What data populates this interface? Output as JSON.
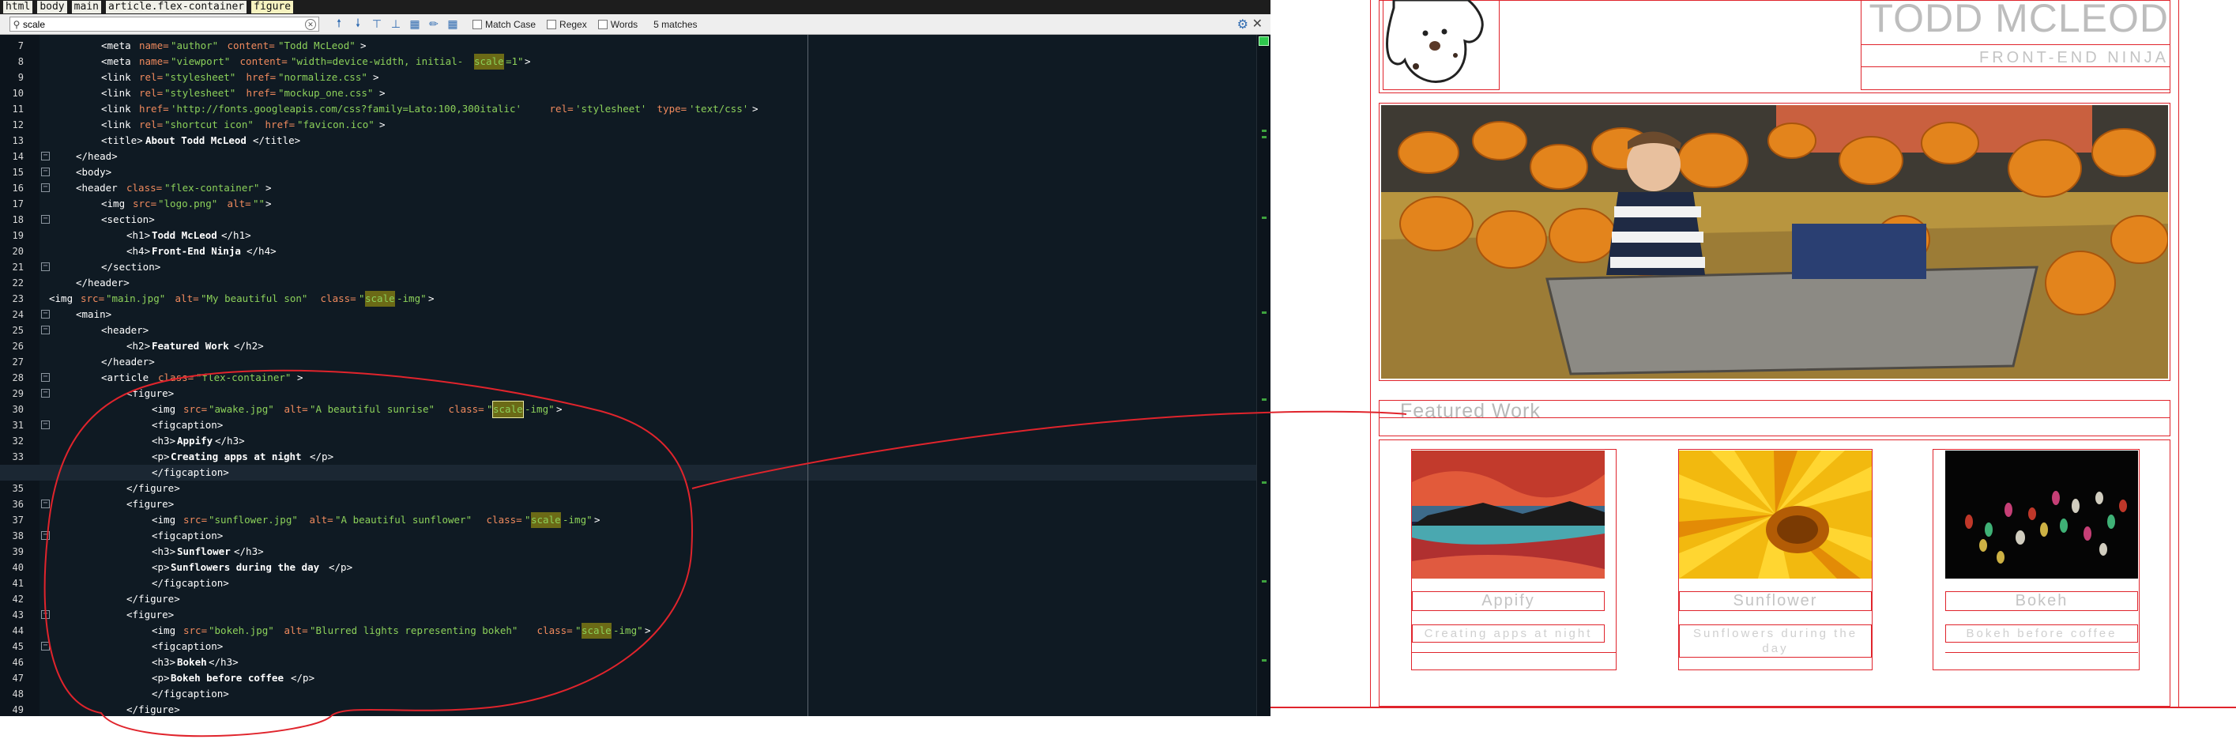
{
  "breadcrumb": [
    "html",
    "body",
    "main",
    "article.flex-container",
    "figure"
  ],
  "search": {
    "value": "scale",
    "match_case_label": "Match Case",
    "regex_label": "Regex",
    "words_label": "Words",
    "matches_label": "5 matches"
  },
  "editor": {
    "lines": [
      {
        "n": "7",
        "p": [
          [
            "t",
            "<meta "
          ],
          [
            "a",
            "name="
          ],
          [
            "s",
            "\"author\""
          ],
          [
            "a",
            " content="
          ],
          [
            "s",
            "\"Todd McLeod\""
          ],
          [
            "t",
            ">"
          ]
        ]
      },
      {
        "n": "8",
        "p": [
          [
            "t",
            "<meta "
          ],
          [
            "a",
            "name="
          ],
          [
            "s",
            "\"viewport\""
          ],
          [
            "a",
            " content="
          ],
          [
            "s",
            "\"width=device-width, initial-"
          ],
          [
            "h",
            "scale"
          ],
          [
            "s",
            "=1\""
          ],
          [
            "t",
            ">"
          ]
        ]
      },
      {
        "n": "9",
        "p": [
          [
            "t",
            "<link "
          ],
          [
            "a",
            "rel="
          ],
          [
            "s",
            "\"stylesheet\""
          ],
          [
            "a",
            " href="
          ],
          [
            "s",
            "\"normalize.css\""
          ],
          [
            "t",
            ">"
          ]
        ]
      },
      {
        "n": "10",
        "p": [
          [
            "t",
            "<link "
          ],
          [
            "a",
            "rel="
          ],
          [
            "s",
            "\"stylesheet\""
          ],
          [
            "a",
            " href="
          ],
          [
            "s",
            "\"mockup_one.css\""
          ],
          [
            "t",
            ">"
          ]
        ]
      },
      {
        "n": "11",
        "p": [
          [
            "t",
            "<link "
          ],
          [
            "a",
            "href="
          ],
          [
            "s",
            "'http://fonts.googleapis.com/css?family=Lato:100,300italic'"
          ],
          [
            "a",
            " rel="
          ],
          [
            "s",
            "'stylesheet'"
          ],
          [
            "a",
            " type="
          ],
          [
            "s",
            "'text/css'"
          ],
          [
            "t",
            ">"
          ]
        ]
      },
      {
        "n": "12",
        "p": [
          [
            "t",
            "<link "
          ],
          [
            "a",
            "rel="
          ],
          [
            "s",
            "\"shortcut icon\""
          ],
          [
            "a",
            " href="
          ],
          [
            "s",
            "\"favicon.ico\""
          ],
          [
            "t",
            ">"
          ]
        ]
      },
      {
        "n": "13",
        "p": [
          [
            "t",
            "<title>"
          ],
          [
            "x",
            "About Todd McLeod"
          ],
          [
            "t",
            "</title>"
          ]
        ]
      },
      {
        "n": "14",
        "p": [
          [
            "t",
            "</head>"
          ]
        ]
      },
      {
        "n": "15",
        "p": [
          [
            "t",
            "<body>"
          ]
        ]
      },
      {
        "n": "16",
        "p": [
          [
            "t",
            "<header "
          ],
          [
            "a",
            "class="
          ],
          [
            "s",
            "\"flex-container\""
          ],
          [
            "t",
            ">"
          ]
        ]
      },
      {
        "n": "17",
        "p": [
          [
            "t",
            "<img "
          ],
          [
            "a",
            "src="
          ],
          [
            "s",
            "\"logo.png\""
          ],
          [
            "a",
            " alt="
          ],
          [
            "s",
            "\"\""
          ],
          [
            "t",
            ">"
          ]
        ]
      },
      {
        "n": "18",
        "p": [
          [
            "t",
            "<section>"
          ]
        ]
      },
      {
        "n": "19",
        "p": [
          [
            "t",
            "<h1>"
          ],
          [
            "x",
            "Todd McLeod"
          ],
          [
            "t",
            "</h1>"
          ]
        ]
      },
      {
        "n": "20",
        "p": [
          [
            "t",
            "<h4>"
          ],
          [
            "x",
            "Front-End Ninja"
          ],
          [
            "t",
            "</h4>"
          ]
        ]
      },
      {
        "n": "21",
        "p": [
          [
            "t",
            "</section>"
          ]
        ]
      },
      {
        "n": "22",
        "p": [
          [
            "t",
            "</header>"
          ]
        ]
      },
      {
        "n": "23",
        "p": [
          [
            "t",
            "<img "
          ],
          [
            "a",
            "src="
          ],
          [
            "s",
            "\"main.jpg\""
          ],
          [
            "a",
            " alt="
          ],
          [
            "s",
            "\"My beautiful son\""
          ],
          [
            "a",
            " class="
          ],
          [
            "s",
            "\""
          ],
          [
            "h",
            "scale"
          ],
          [
            "s",
            "-img\""
          ],
          [
            "t",
            ">"
          ]
        ]
      },
      {
        "n": "24",
        "p": [
          [
            "t",
            "<main>"
          ]
        ]
      },
      {
        "n": "25",
        "p": [
          [
            "t",
            "<header>"
          ]
        ]
      },
      {
        "n": "26",
        "p": [
          [
            "t",
            "<h2>"
          ],
          [
            "x",
            "Featured Work"
          ],
          [
            "t",
            "</h2>"
          ]
        ]
      },
      {
        "n": "27",
        "p": [
          [
            "t",
            "</header>"
          ]
        ]
      },
      {
        "n": "28",
        "p": [
          [
            "t",
            "<article "
          ],
          [
            "a",
            "class="
          ],
          [
            "s",
            "\"flex-container\""
          ],
          [
            "t",
            ">"
          ]
        ]
      },
      {
        "n": "29",
        "p": [
          [
            "t",
            "<figure>"
          ]
        ]
      },
      {
        "n": "30",
        "p": [
          [
            "t",
            "<img "
          ],
          [
            "a",
            "src="
          ],
          [
            "s",
            "\"awake.jpg\""
          ],
          [
            "a",
            " alt="
          ],
          [
            "s",
            "\"A beautiful sunrise\""
          ],
          [
            "a",
            " class="
          ],
          [
            "s",
            "\""
          ],
          [
            "b",
            "scale"
          ],
          [
            "s",
            "-img\""
          ],
          [
            "t",
            ">"
          ]
        ]
      },
      {
        "n": "31",
        "p": [
          [
            "t",
            "<figcaption>"
          ]
        ]
      },
      {
        "n": "32",
        "p": [
          [
            "t",
            "<h3>"
          ],
          [
            "x",
            "Appify"
          ],
          [
            "t",
            "</h3>"
          ]
        ]
      },
      {
        "n": "33",
        "p": [
          [
            "t",
            "<p>"
          ],
          [
            "x",
            "Creating apps at night"
          ],
          [
            "t",
            "</p>"
          ]
        ]
      },
      {
        "n": "34",
        "p": [
          [
            "t",
            "</figcaption>"
          ]
        ]
      },
      {
        "n": "35",
        "p": [
          [
            "t",
            "</figure>"
          ]
        ]
      },
      {
        "n": "36",
        "p": [
          [
            "t",
            "<figure>"
          ]
        ]
      },
      {
        "n": "37",
        "p": [
          [
            "t",
            "<img "
          ],
          [
            "a",
            "src="
          ],
          [
            "s",
            "\"sunflower.jpg\""
          ],
          [
            "a",
            " alt="
          ],
          [
            "s",
            "\"A beautiful sunflower\""
          ],
          [
            "a",
            " class="
          ],
          [
            "s",
            "\""
          ],
          [
            "h",
            "scale"
          ],
          [
            "s",
            "-img\""
          ],
          [
            "t",
            ">"
          ]
        ]
      },
      {
        "n": "38",
        "p": [
          [
            "t",
            "<figcaption>"
          ]
        ]
      },
      {
        "n": "39",
        "p": [
          [
            "t",
            "<h3>"
          ],
          [
            "x",
            "Sunflower"
          ],
          [
            "t",
            "</h3>"
          ]
        ]
      },
      {
        "n": "40",
        "p": [
          [
            "t",
            "<p>"
          ],
          [
            "x",
            "Sunflowers during the day"
          ],
          [
            "t",
            "</p>"
          ]
        ]
      },
      {
        "n": "41",
        "p": [
          [
            "t",
            "</figcaption>"
          ]
        ]
      },
      {
        "n": "42",
        "p": [
          [
            "t",
            "</figure>"
          ]
        ]
      },
      {
        "n": "43",
        "p": [
          [
            "t",
            "<figure>"
          ]
        ]
      },
      {
        "n": "44",
        "p": [
          [
            "t",
            "<img "
          ],
          [
            "a",
            "src="
          ],
          [
            "s",
            "\"bokeh.jpg\""
          ],
          [
            "a",
            " alt="
          ],
          [
            "s",
            "\"Blurred lights representing bokeh\""
          ],
          [
            "a",
            " class="
          ],
          [
            "s",
            "\""
          ],
          [
            "h",
            "scale"
          ],
          [
            "s",
            "-img\""
          ],
          [
            "t",
            ">"
          ]
        ]
      },
      {
        "n": "45",
        "p": [
          [
            "t",
            "<figcaption>"
          ]
        ]
      },
      {
        "n": "46",
        "p": [
          [
            "t",
            "<h3>"
          ],
          [
            "x",
            "Bokeh"
          ],
          [
            "t",
            "</h3>"
          ]
        ]
      },
      {
        "n": "47",
        "p": [
          [
            "t",
            "<p>"
          ],
          [
            "x",
            "Bokeh before coffee"
          ],
          [
            "t",
            "</p>"
          ]
        ]
      },
      {
        "n": "48",
        "p": [
          [
            "t",
            "</figcaption>"
          ]
        ]
      },
      {
        "n": "49",
        "p": [
          [
            "t",
            "</figure>"
          ]
        ]
      }
    ]
  },
  "preview": {
    "site_title": "TODD MCLEOD",
    "site_subtitle": "FRONT-END NINJA",
    "featured_heading": "Featured Work",
    "figures": [
      {
        "title": "Appify",
        "caption": "Creating apps at night"
      },
      {
        "title": "Sunflower",
        "caption": "Sunflowers during the day"
      },
      {
        "title": "Bokeh",
        "caption": "Bokeh before coffee"
      }
    ]
  },
  "colors": {
    "annotation_red": "#e0242c",
    "editor_bg": "#0f1a23",
    "search_highlight": "#6b6a16"
  },
  "icons": [
    "search-icon",
    "clear-search-icon",
    "find-previous-icon",
    "find-next-icon",
    "select-all-icon",
    "gear-icon",
    "close-icon",
    "dog-logo-icon"
  ]
}
